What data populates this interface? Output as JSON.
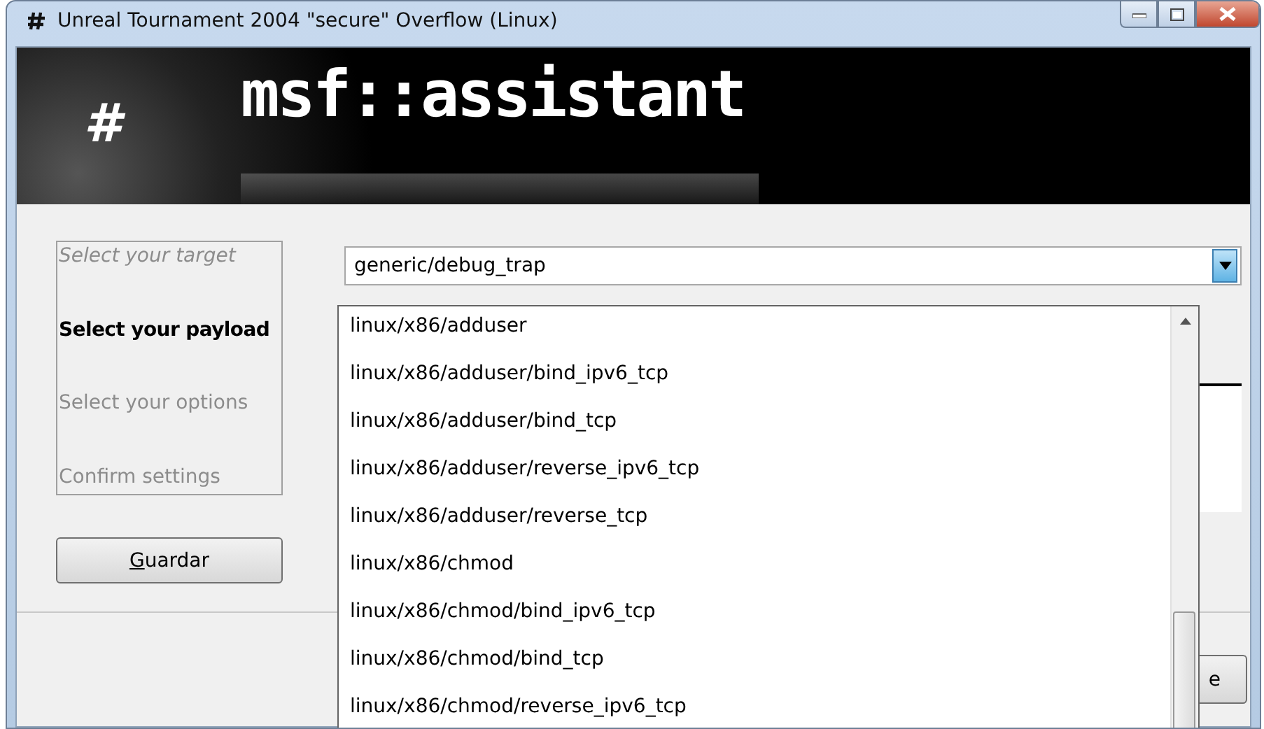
{
  "window": {
    "title": "Unreal Tournament 2004 \"secure\" Overflow (Linux)"
  },
  "banner": {
    "hash": "#",
    "logo": "msf::assistant"
  },
  "steps": [
    {
      "label": "Select your target",
      "selected": false,
      "italic": true
    },
    {
      "label": "Select your payload",
      "selected": true,
      "italic": false
    },
    {
      "label": "Select your options",
      "selected": false,
      "italic": false
    },
    {
      "label": "Confirm settings",
      "selected": false,
      "italic": false
    }
  ],
  "save_button": "Guardar",
  "payload_combo": {
    "value": "generic/debug_trap",
    "expanded": true
  },
  "dropdown_items": [
    "linux/x86/adduser",
    "linux/x86/adduser/bind_ipv6_tcp",
    "linux/x86/adduser/bind_tcp",
    "linux/x86/adduser/reverse_ipv6_tcp",
    "linux/x86/adduser/reverse_tcp",
    "linux/x86/chmod",
    "linux/x86/chmod/bind_ipv6_tcp",
    "linux/x86/chmod/bind_tcp",
    "linux/x86/chmod/reverse_ipv6_tcp"
  ],
  "partial_button": "e"
}
